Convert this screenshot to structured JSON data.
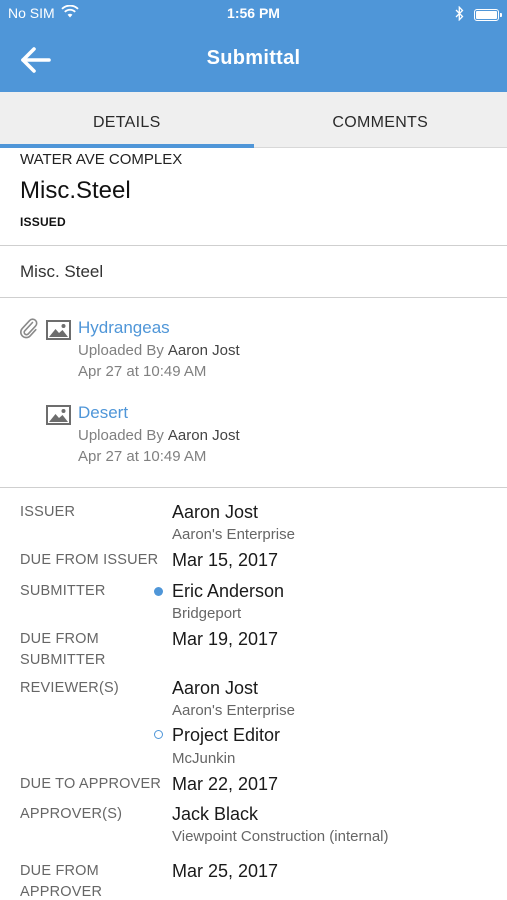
{
  "status_bar": {
    "carrier": "No SIM",
    "time": "1:56 PM",
    "battery_level": 1.0,
    "icons": [
      "wifi-icon",
      "bluetooth-icon",
      "battery-icon"
    ]
  },
  "nav": {
    "title": "Submittal",
    "back_icon": "arrow-left-icon"
  },
  "tabs": [
    {
      "label": "DETAILS",
      "active": true
    },
    {
      "label": "COMMENTS",
      "active": false
    }
  ],
  "header": {
    "project": "WATER AVE COMPLEX",
    "title": "Misc.Steel",
    "status": "ISSUED"
  },
  "description": "Misc. Steel",
  "attachments": {
    "uploaded_by_label": "Uploaded By",
    "items": [
      {
        "name": "Hydrangeas",
        "uploader": "Aaron Jost",
        "date": "Apr 27 at 10:49 AM",
        "icon": "image-icon"
      },
      {
        "name": "Desert",
        "uploader": "Aaron Jost",
        "date": "Apr 27 at 10:49 AM",
        "icon": "image-icon"
      }
    ]
  },
  "details": {
    "issuer_label": "ISSUER",
    "issuer_name": "Aaron Jost",
    "issuer_company": "Aaron's Enterprise",
    "due_from_issuer_label": "DUE FROM ISSUER",
    "due_from_issuer": "Mar 15, 2017",
    "submitter_label": "SUBMITTER",
    "submitter_name": "Eric Anderson",
    "submitter_company": "Bridgeport",
    "due_from_submitter_label_1": "DUE FROM",
    "due_from_submitter_label_2": "SUBMITTER",
    "due_from_submitter": "Mar 19, 2017",
    "reviewers_label": "REVIEWER(S)",
    "reviewer1_name": "Aaron Jost",
    "reviewer1_company": "Aaron's Enterprise",
    "reviewer2_name": "Project Editor",
    "reviewer2_company": "McJunkin",
    "due_to_approver_label": "DUE TO APPROVER",
    "due_to_approver": "Mar 22, 2017",
    "approvers_label": "APPROVER(S)",
    "approver_name": "Jack Black",
    "approver_company": "Viewpoint Construction (internal)",
    "due_from_approver_label_1": "DUE FROM",
    "due_from_approver_label_2": "APPROVER",
    "due_from_approver": "Mar 25, 2017"
  },
  "colors": {
    "accent": "#4f96d8",
    "tab_background": "#efefef",
    "link": "#4f96d8"
  }
}
